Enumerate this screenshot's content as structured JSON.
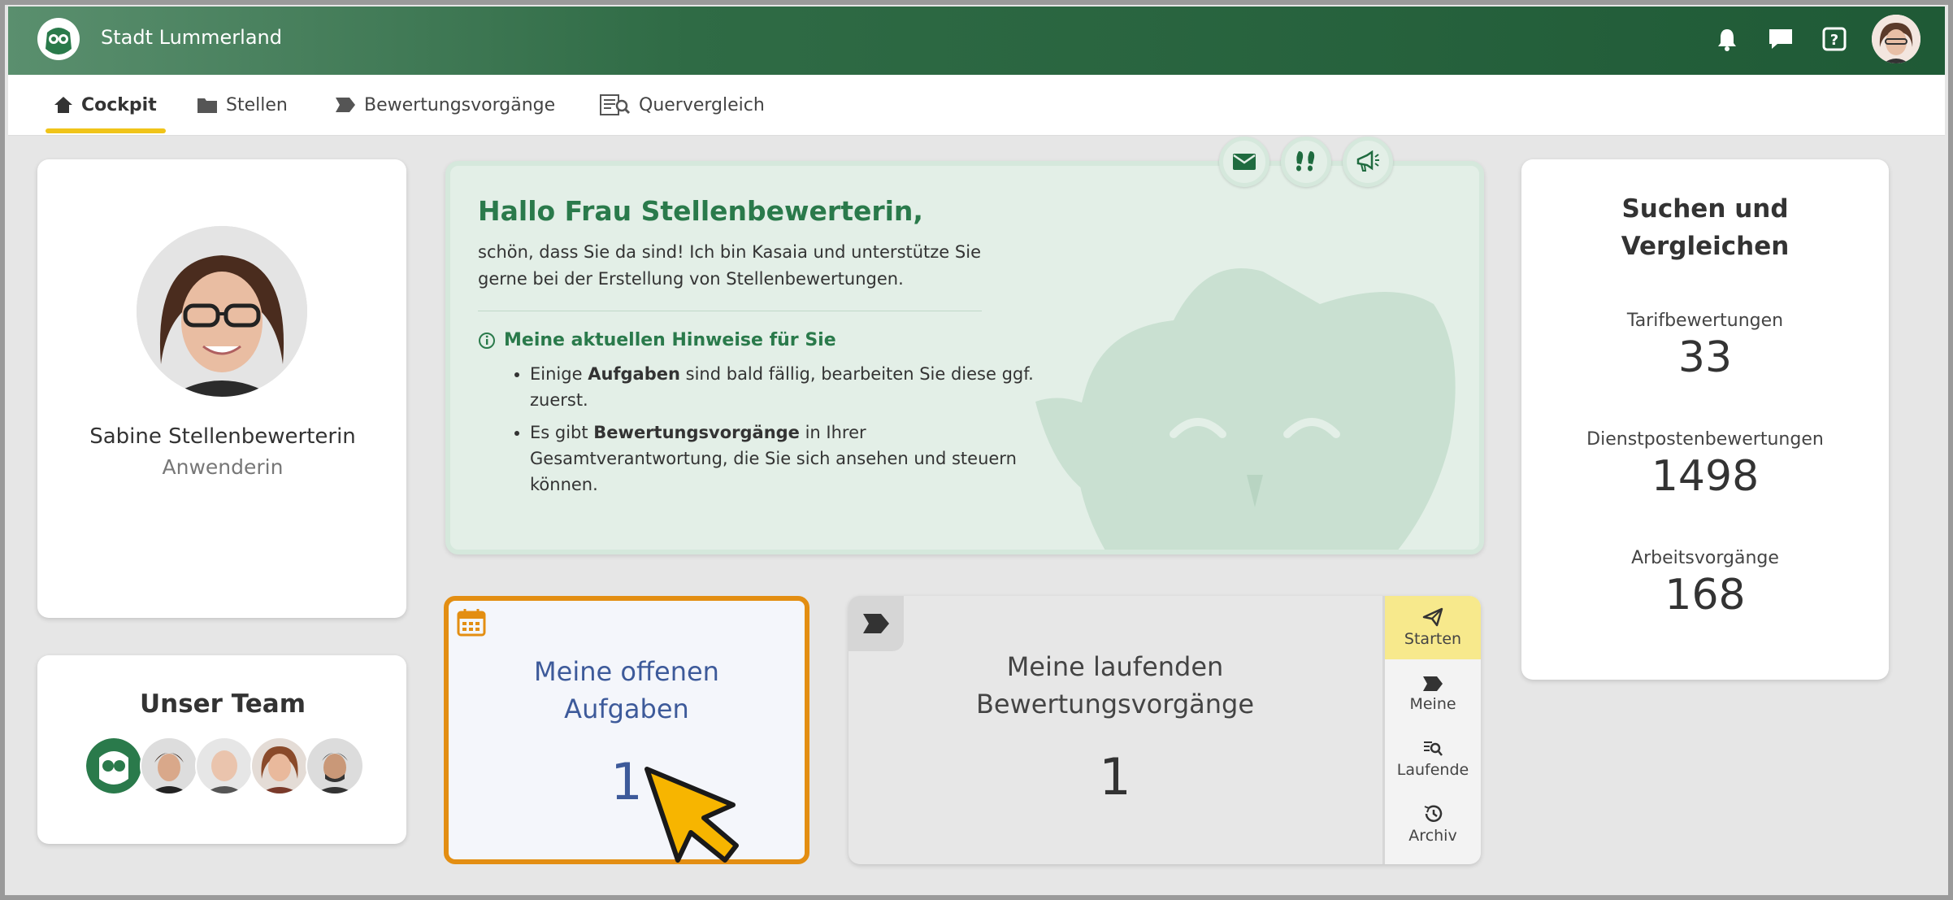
{
  "app": {
    "title": "Stadt Lummerland"
  },
  "topbar_icons": [
    "bell-icon",
    "chat-icon",
    "help-icon",
    "user-avatar"
  ],
  "tabs": [
    {
      "label": "Cockpit",
      "icon": "house-icon",
      "active": true
    },
    {
      "label": "Stellen",
      "icon": "folder-icon",
      "active": false
    },
    {
      "label": "Bewertungsvorgänge",
      "icon": "tag-icon",
      "active": false
    },
    {
      "label": "Quervergleich",
      "icon": "compare-icon",
      "active": false
    }
  ],
  "profile": {
    "name": "Sabine Stellenbewerterin",
    "role": "Anwenderin"
  },
  "team": {
    "title": "Unser Team",
    "members": 5
  },
  "welcome": {
    "title": "Hallo Frau Stellenbewerterin,",
    "text": "schön, dass Sie da sind! Ich bin Kasaia und unterstütze Sie gerne bei der Erstellung von Stellenbewertungen.",
    "hints_title": "Meine aktuellen Hinweise für Sie",
    "hints": [
      {
        "pre": "Einige ",
        "bold": "Aufgaben",
        "post": " sind bald fällig, bearbeiten Sie diese ggf. zuerst."
      },
      {
        "pre": "Es gibt ",
        "bold": "Bewertungsvorgänge",
        "post": " in Ihrer Gesamtverantwortung, die Sie sich ansehen und steuern können."
      }
    ]
  },
  "stats": {
    "title_line1": "Suchen und",
    "title_line2": "Vergleichen",
    "items": [
      {
        "label": "Tarifbewertungen",
        "value": "33"
      },
      {
        "label": "Dienstpostenbewertungen",
        "value": "1498"
      },
      {
        "label": "Arbeitsvorgänge",
        "value": "168"
      }
    ]
  },
  "tasks": {
    "title_line1": "Meine offenen",
    "title_line2": "Aufgaben",
    "count": "1"
  },
  "running": {
    "title_line1": "Meine laufenden",
    "title_line2": "Bewertungsvorgänge",
    "count": "1",
    "menu": [
      {
        "label": "Starten",
        "icon": "send-icon"
      },
      {
        "label": "Meine",
        "icon": "tag-icon"
      },
      {
        "label": "Laufende",
        "icon": "list-search-icon"
      },
      {
        "label": "Archiv",
        "icon": "history-icon"
      }
    ]
  },
  "colors": {
    "brand_green": "#2a7a4b",
    "accent_orange": "#e38e12",
    "accent_yellow": "#f0c419",
    "task_blue": "#3d5a9a"
  }
}
